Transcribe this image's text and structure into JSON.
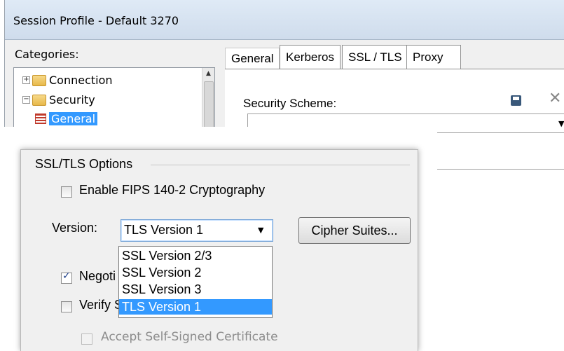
{
  "window": {
    "title": "Session Profile - Default 3270"
  },
  "categories": {
    "label": "Categories:",
    "items": [
      {
        "label": "Connection",
        "expander": "+"
      },
      {
        "label": "Security",
        "expander": "−"
      },
      {
        "label": "General",
        "selected": true
      }
    ]
  },
  "tabs": [
    {
      "label": "General",
      "active": true
    },
    {
      "label": "Kerberos"
    },
    {
      "label": "SSL / TLS"
    },
    {
      "label": "Proxy"
    }
  ],
  "security": {
    "scheme_label": "Security Scheme:",
    "scheme_value": ""
  },
  "icons": {
    "save": "save-icon",
    "close": "close-icon",
    "dropdown": "chevron-down-icon"
  },
  "ssl_tls": {
    "group_title": "SSL/TLS Options",
    "fips_label": "Enable FIPS 140-2 Cryptography",
    "fips_checked": false,
    "version_label": "Version:",
    "version_value": "TLS Version 1",
    "cipher_button": "Cipher Suites...",
    "version_options": [
      "SSL Version 2/3",
      "SSL Version 2",
      "SSL Version 3",
      "TLS Version 1"
    ],
    "negotiate_label": "Negoti",
    "negotiate_checked": true,
    "verify_label": "Verify S",
    "verify_checked": false,
    "accept_label": "Accept Self-Signed Certificate",
    "accept_checked": false
  },
  "colors": {
    "selection": "#3399ff",
    "titlebar": "#dfeaf6",
    "dialog_bg": "#f0f0f0"
  }
}
